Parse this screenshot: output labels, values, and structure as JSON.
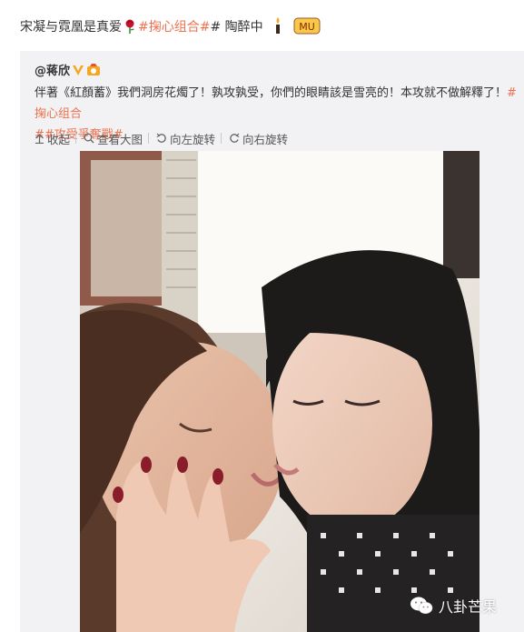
{
  "post": {
    "text": "宋凝与霓凰是真爱",
    "hashtag": "#掬心组合#",
    "suffix": "# 陶醉中",
    "emojis": [
      "rose-icon",
      "candle-icon",
      "mu-emoji-icon"
    ]
  },
  "repost": {
    "author": "@蒋欣",
    "badges": [
      "verified-v-icon",
      "medal-icon"
    ],
    "line1_text": "伴著《紅顏蓄》我們洞房花燭了！孰攻孰受，你們的眼睛該是雪亮的！本攻就不做解釋了！",
    "line1_tag": "#掬心组合",
    "line2_tag": "##攻受爭奪戰#"
  },
  "toolbar": {
    "collapse": "收起",
    "view_large": "查看大图",
    "rotate_left": "向左旋转",
    "rotate_right": "向右旋转"
  },
  "watermark": {
    "text": "八卦芒果"
  },
  "colors": {
    "tag": "#eb7350",
    "page_border": "#f6c9d6",
    "verified": "#f5a623"
  }
}
